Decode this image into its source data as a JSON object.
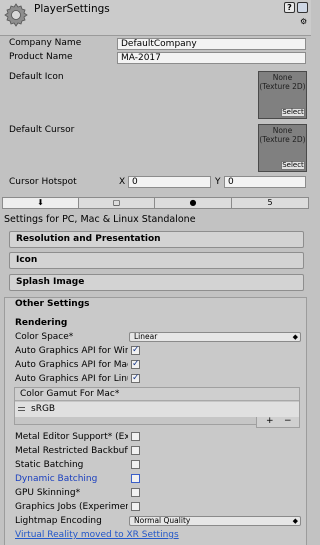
{
  "header": {
    "title": "PlayerSettings",
    "help_icon": "?",
    "preset_icon": "preset-icon",
    "menu_icon": "gear-menu-icon"
  },
  "company": {
    "label": "Company Name",
    "value": "DefaultCompany"
  },
  "product": {
    "label": "Product Name",
    "value": "MA-2017"
  },
  "default_icon": {
    "label": "Default Icon",
    "none": "None",
    "type": "(Texture 2D)",
    "select": "Select"
  },
  "default_cursor": {
    "label": "Default Cursor",
    "none": "None",
    "type": "(Texture 2D)",
    "select": "Select"
  },
  "hotspot": {
    "label": "Cursor Hotspot",
    "x_label": "X",
    "x_value": "0",
    "y_label": "Y",
    "y_value": "0"
  },
  "tabs": [
    {
      "icon": "download-icon",
      "glyph": "⬇"
    },
    {
      "icon": "windows-store-icon",
      "glyph": "▢"
    },
    {
      "icon": "android-icon",
      "glyph": "●"
    },
    {
      "icon": "html5-icon",
      "glyph": "5"
    }
  ],
  "platform_title": "Settings for PC, Mac & Linux Standalone",
  "sections": {
    "resolution": "Resolution and Presentation",
    "icon": "Icon",
    "splash": "Splash Image",
    "other": "Other Settings"
  },
  "rendering": {
    "heading": "Rendering",
    "color_space": {
      "label": "Color Space*",
      "value": "Linear"
    },
    "auto_windows": {
      "label": "Auto Graphics API for Windows",
      "checked": true
    },
    "auto_mac": {
      "label": "Auto Graphics API for Mac",
      "checked": true
    },
    "auto_linux": {
      "label": "Auto Graphics API for Linux",
      "checked": true
    },
    "gamut": {
      "heading": "Color Gamut For Mac*",
      "item": "sRGB",
      "add": "+",
      "remove": "−"
    },
    "metal_editor": {
      "label": "Metal Editor Support* (Experimental)",
      "checked": false
    },
    "metal_backbuffer": {
      "label": "Metal Restricted Backbuffer Use",
      "checked": false
    },
    "static_batching": {
      "label": "Static Batching",
      "checked": false
    },
    "dynamic_batching": {
      "label": "Dynamic Batching",
      "checked": false
    },
    "gpu_skinning": {
      "label": "GPU Skinning*",
      "checked": false
    },
    "graphics_jobs": {
      "label": "Graphics Jobs (Experimental)",
      "checked": false
    },
    "lightmap": {
      "label": "Lightmap Encoding",
      "value": "Normal Quality"
    },
    "vr_link": "Virtual Reality moved to XR Settings"
  }
}
